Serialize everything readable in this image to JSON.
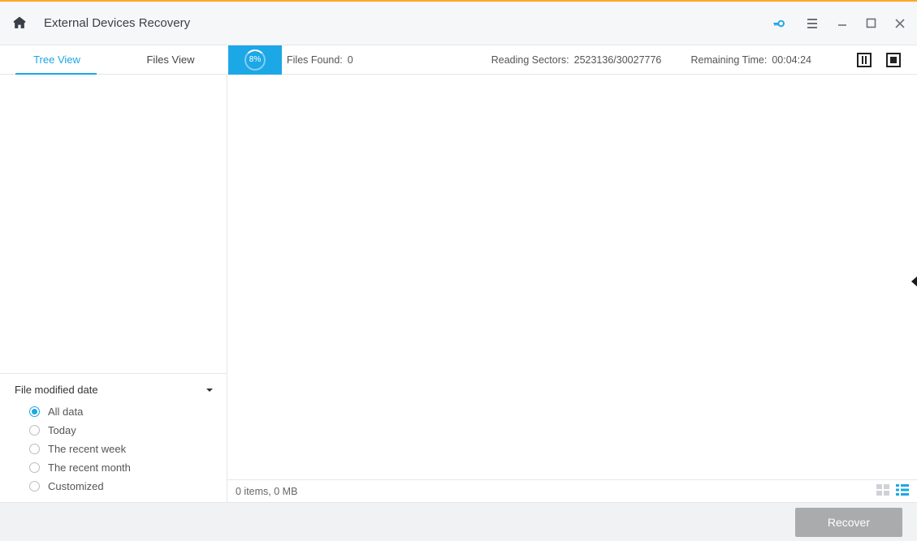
{
  "header": {
    "title": "External Devices Recovery"
  },
  "tabs": {
    "tree": "Tree View",
    "files": "Files View"
  },
  "progress": {
    "percent": "8%",
    "files_found_label": "Files Found:",
    "files_found_value": "0",
    "reading_sectors_label": "Reading Sectors:",
    "reading_sectors_value": "2523136/30027776",
    "remaining_time_label": "Remaining Time:",
    "remaining_time_value": "00:04:24"
  },
  "filter": {
    "title": "File modified date",
    "options": {
      "all": "All data",
      "today": "Today",
      "week": "The recent week",
      "month": "The recent month",
      "custom": "Customized"
    }
  },
  "content": {
    "status": "0 items, 0 MB"
  },
  "footer": {
    "recover": "Recover"
  }
}
